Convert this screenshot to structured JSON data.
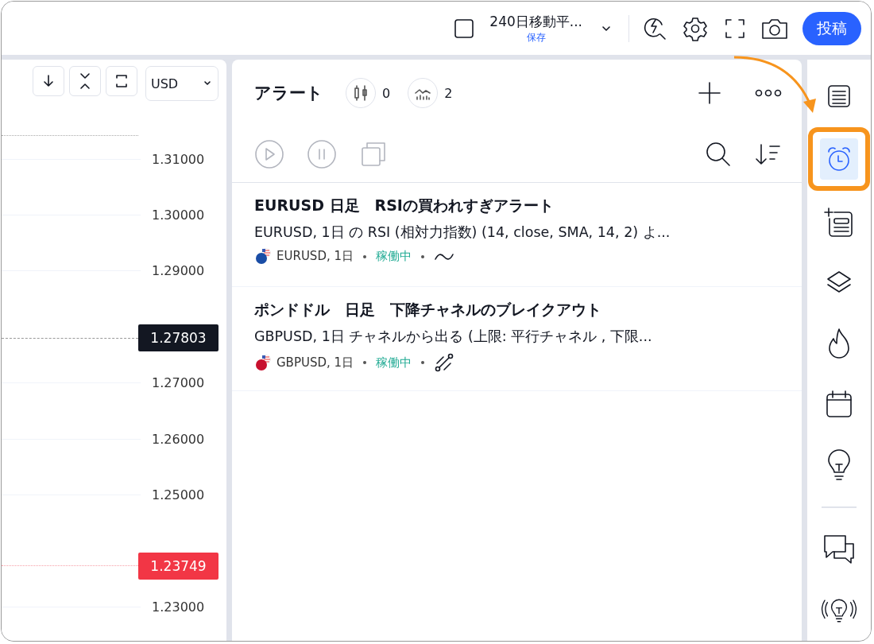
{
  "topbar": {
    "layout_name": "240日移動平...",
    "save_status": "保存",
    "post_button": "投稿"
  },
  "chart": {
    "currency": "USD",
    "price_axis": [
      {
        "kind": "label",
        "text": "1.31000"
      },
      {
        "kind": "label",
        "text": "1.30000"
      },
      {
        "kind": "label",
        "text": "1.29000"
      },
      {
        "kind": "last",
        "text": "1.27803"
      },
      {
        "kind": "label",
        "text": "1.27000"
      },
      {
        "kind": "label",
        "text": "1.26000"
      },
      {
        "kind": "label",
        "text": "1.25000"
      },
      {
        "kind": "bid",
        "text": "1.23749"
      },
      {
        "kind": "label",
        "text": "1.23000"
      }
    ]
  },
  "alerts_panel": {
    "title": "アラート",
    "counters": [
      {
        "kind": "price",
        "text": "0"
      },
      {
        "kind": "indicator",
        "text": "2"
      }
    ],
    "alerts": [
      {
        "title": "EURUSD 日足　RSIの買われすぎアラート",
        "description": "EURUSD, 1日 の RSI (相対力指数) (14, close, SMA, 14, 2) よ...",
        "symbol": "EURUSD, 1日",
        "color": "#1a4da6",
        "status": "稼働中",
        "kind": "indicator"
      },
      {
        "title": "ポンドドル　日足　下降チャネルのブレイクアウト",
        "description": "GBPUSD, 1日 チャネルから出る (上限: 平行チャネル , 下限...",
        "symbol": "GBPUSD, 1日",
        "color": "#c8102e",
        "status": "稼働中",
        "kind": "drawing"
      }
    ]
  },
  "sidebar": {
    "items": [
      {
        "kind": "watchlist",
        "selected": false,
        "highlighted": false
      },
      {
        "kind": "alerts",
        "selected": true,
        "highlighted": true
      },
      {
        "kind": "details",
        "selected": false,
        "highlighted": false
      },
      {
        "kind": "layers",
        "selected": false,
        "highlighted": false
      },
      {
        "kind": "hotlist",
        "selected": false,
        "highlighted": false
      },
      {
        "kind": "calendar",
        "selected": false,
        "highlighted": false
      },
      {
        "kind": "ideas",
        "selected": false,
        "highlighted": false
      },
      {
        "kind": "chat",
        "selected": false,
        "highlighted": false
      },
      {
        "kind": "streams",
        "selected": false,
        "highlighted": false
      }
    ]
  }
}
